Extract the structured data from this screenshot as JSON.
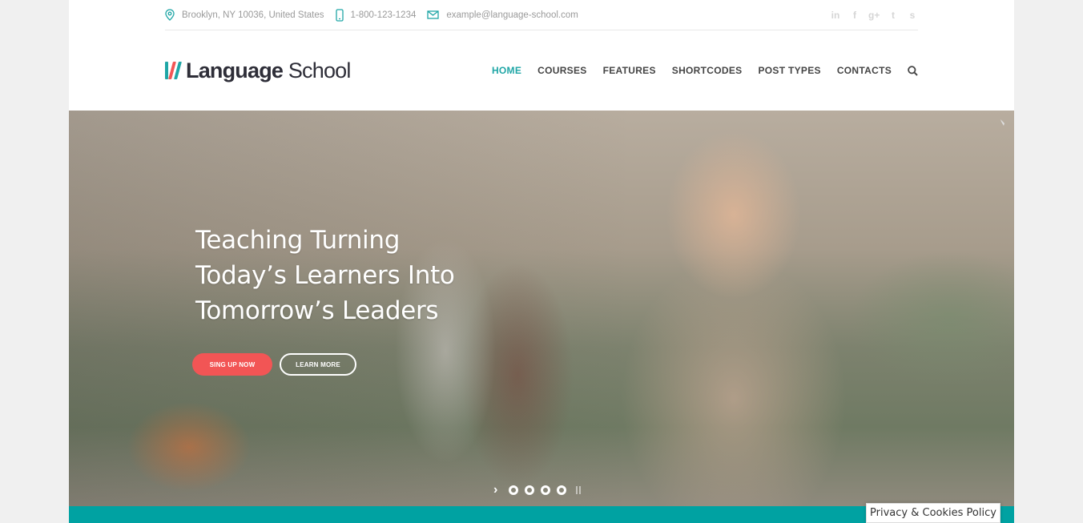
{
  "topbar": {
    "address": "Brooklyn, NY 10036, United States",
    "phone": "1-800-123-1234",
    "email": "example@language-school.com",
    "social": [
      {
        "name": "linkedin-icon",
        "glyph": "in"
      },
      {
        "name": "facebook-icon",
        "glyph": "f"
      },
      {
        "name": "google-plus-icon",
        "glyph": "g+"
      },
      {
        "name": "twitter-icon",
        "glyph": "t"
      },
      {
        "name": "skype-icon",
        "glyph": "s"
      }
    ]
  },
  "logo": {
    "bold": "Language",
    "light": " School",
    "colors": [
      "#1fa6a6",
      "#f25555",
      "#1fa6a6"
    ]
  },
  "nav": {
    "items": [
      {
        "label": "HOME",
        "active": true
      },
      {
        "label": "COURSES"
      },
      {
        "label": "FEATURES"
      },
      {
        "label": "SHORTCODES"
      },
      {
        "label": "POST TYPES"
      },
      {
        "label": "CONTACTS"
      }
    ],
    "accent": "#1fa6a6"
  },
  "hero": {
    "title_lines": [
      "Teaching Turning",
      "Today’s Learners Into",
      "Tomorrow’s Leaders"
    ],
    "primary_button": "SING UP NOW",
    "secondary_button": "LEARN MORE",
    "slides_count": 4,
    "primary_color": "#f25555"
  },
  "footer": {
    "privacy_label": "Privacy & Cookies Policy",
    "bar_color": "#00a2a2"
  }
}
